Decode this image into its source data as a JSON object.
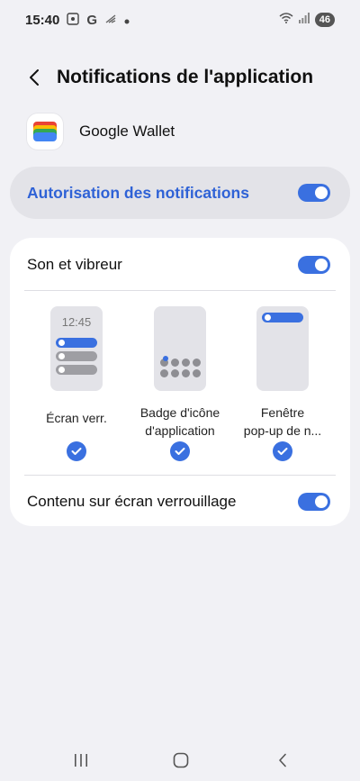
{
  "status_bar": {
    "time": "15:40",
    "g_letter": "G",
    "battery": "46"
  },
  "header": {
    "title": "Notifications de l'application"
  },
  "app": {
    "name": "Google Wallet"
  },
  "permission": {
    "label": "Autorisation des notifications",
    "enabled": true
  },
  "settings": {
    "sound": {
      "label": "Son et vibreur",
      "enabled": true
    },
    "styles": [
      {
        "label": "Écran verr.",
        "preview_time": "12:45",
        "checked": true
      },
      {
        "label": "Badge d'icône d'application",
        "line1": "Badge d'icône",
        "line2": "d'application",
        "checked": true
      },
      {
        "label": "Fenêtre pop-up de n...",
        "line1": "Fenêtre",
        "line2": "pop-up de n...",
        "checked": true
      }
    ],
    "lockscreen": {
      "label": "Contenu sur écran verrouillage",
      "enabled": true
    }
  },
  "colors": {
    "accent": "#3a70e0",
    "accent_text": "#2f62d6",
    "background": "#f1f1f5",
    "card": "#ffffff"
  }
}
